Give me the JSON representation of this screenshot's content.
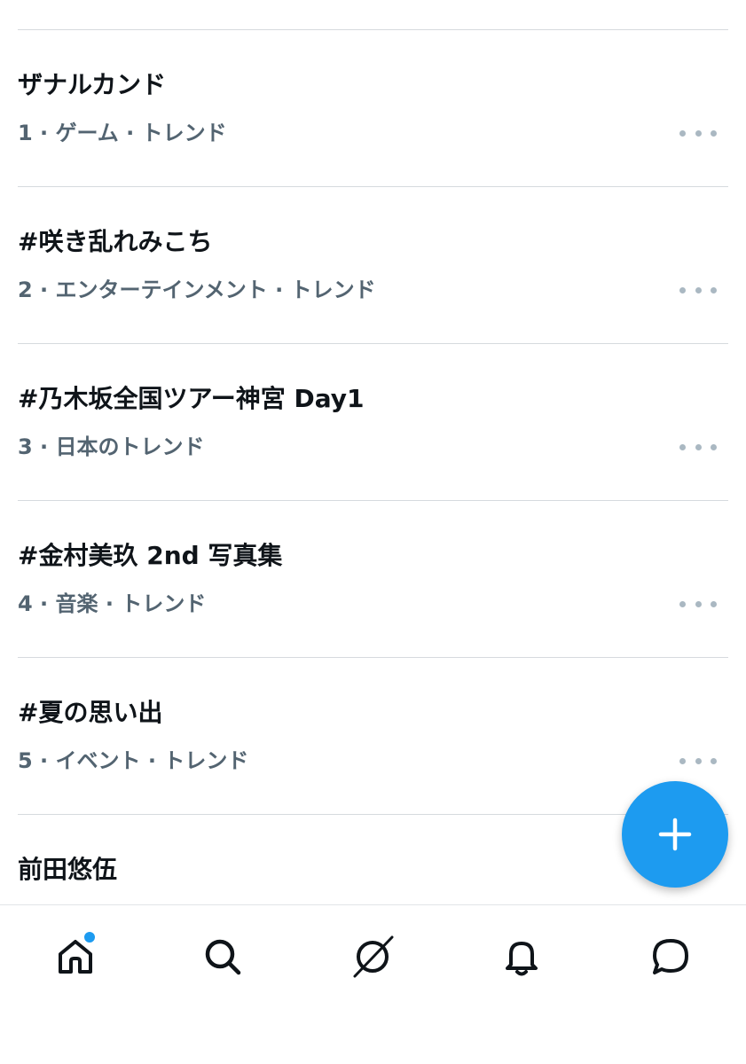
{
  "trends": [
    {
      "title": "ザナルカンド",
      "meta": "1 · ゲーム · トレンド"
    },
    {
      "title": "#咲き乱れみこち",
      "meta": "2 · エンターテインメント · トレンド"
    },
    {
      "title": "#乃木坂全国ツアー神宮 Day1",
      "meta": "3 · 日本のトレンド"
    },
    {
      "title": "#金村美玖 2nd 写真集",
      "meta": "4 · 音楽 · トレンド"
    },
    {
      "title": "#夏の思い出",
      "meta": "5 · イベント · トレンド"
    },
    {
      "title": "前田悠伍",
      "meta": ""
    }
  ],
  "icons": {
    "more": "more-horizontal-icon",
    "compose": "plus-icon",
    "home": "home-icon",
    "search": "search-icon",
    "spaces": "slash-circle-icon",
    "notifications": "bell-icon",
    "messages": "chat-bubble-icon"
  },
  "colors": {
    "accent": "#1d9bf0",
    "text_primary": "#0f1419",
    "text_secondary": "#536471",
    "divider": "#d6dade"
  }
}
